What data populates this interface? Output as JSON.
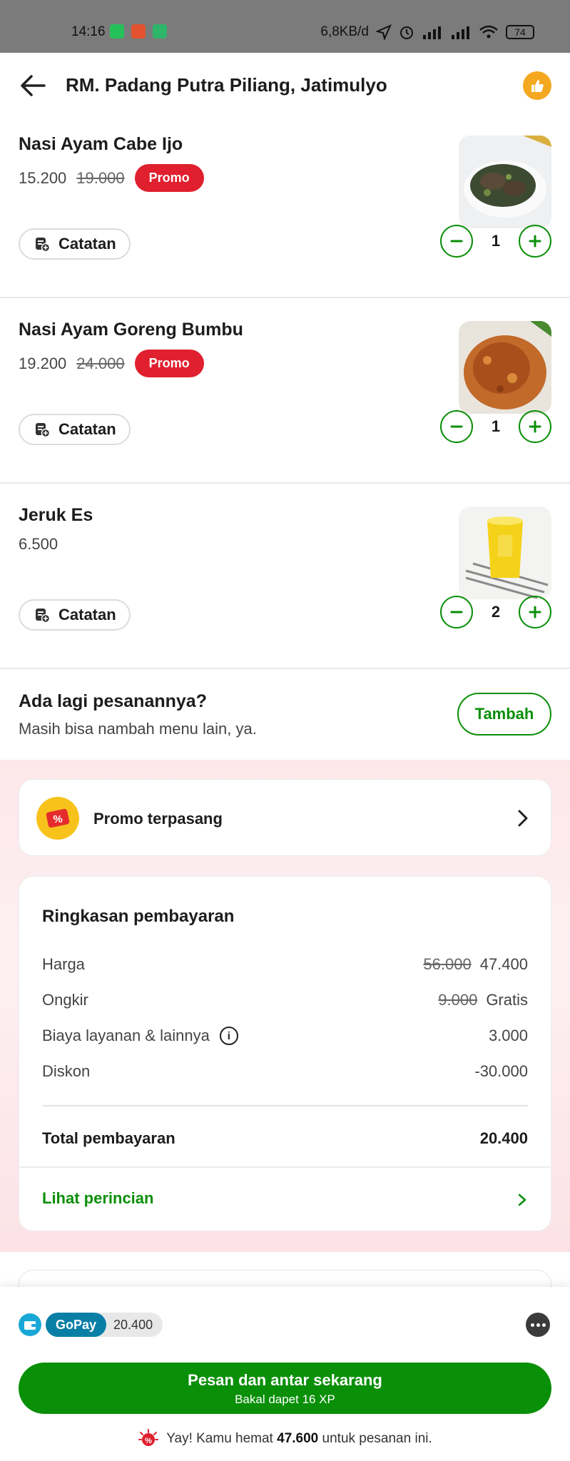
{
  "status_bar": {
    "time": "14:16",
    "network_speed": "6,8KB/d",
    "battery": "74"
  },
  "header": {
    "title": "RM. Padang Putra Piliang, Jatimulyo"
  },
  "items": [
    {
      "name": "Nasi Ayam Cabe Ijo",
      "price": "15.200",
      "original_price": "19.000",
      "badge": "Promo",
      "note_label": "Catatan",
      "quantity": "1"
    },
    {
      "name": "Nasi Ayam Goreng Bumbu",
      "price": "19.200",
      "original_price": "24.000",
      "badge": "Promo",
      "note_label": "Catatan",
      "quantity": "1"
    },
    {
      "name": "Jeruk Es",
      "price": "6.500",
      "note_label": "Catatan",
      "quantity": "2"
    }
  ],
  "add_more": {
    "heading": "Ada lagi pesanannya?",
    "subtext": "Masih bisa nambah menu lain, ya.",
    "button": "Tambah"
  },
  "promo": {
    "label": "Promo terpasang"
  },
  "summary": {
    "title": "Ringkasan pembayaran",
    "rows": [
      {
        "label": "Harga",
        "old": "56.000",
        "value": "47.400"
      },
      {
        "label": "Ongkir",
        "old": "9.000",
        "value": "Gratis"
      },
      {
        "label": "Biaya layanan & lainnya",
        "value": "3.000"
      },
      {
        "label": "Diskon",
        "value": "-30.000"
      }
    ],
    "total_label": "Total pembayaran",
    "total_value": "20.400",
    "details_link": "Lihat perincian"
  },
  "payment": {
    "method": "GoPay",
    "amount": "20.400"
  },
  "order_button": {
    "label": "Pesan dan antar sekarang",
    "sub": "Bakal dapet 16 XP"
  },
  "savings": {
    "prefix": "Yay! Kamu hemat",
    "amount": "47.600",
    "suffix": "untuk pesanan ini."
  },
  "colors": {
    "primary_green": "#0a8f08",
    "promo_red": "#e0202f",
    "gopay_blue": "#0a7fa6",
    "thumb_orange": "#f4a81f"
  }
}
